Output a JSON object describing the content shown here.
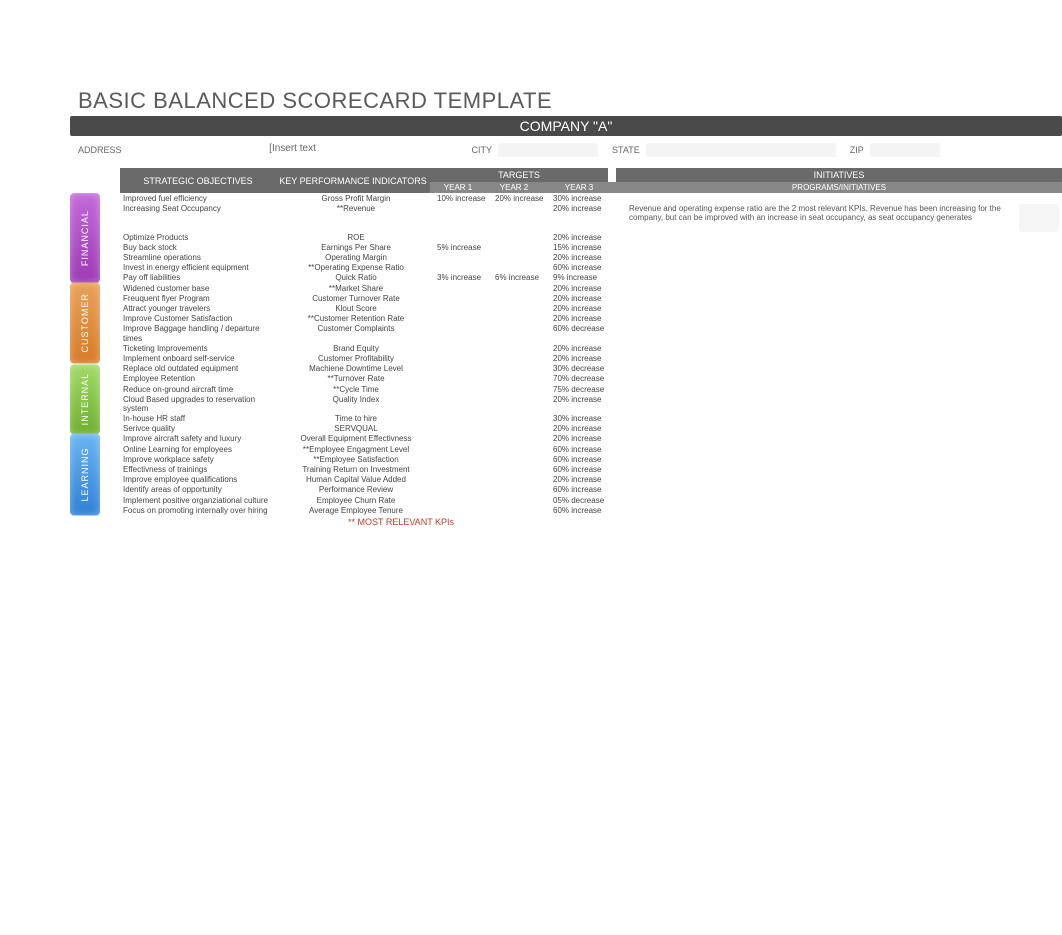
{
  "title": "BASIC BALANCED SCORECARD TEMPLATE",
  "company": "COMPANY \"A\"",
  "address": {
    "label": "ADDRESS",
    "value": "[Insert text",
    "city_label": "CITY",
    "state_label": "STATE",
    "zip_label": "ZIP"
  },
  "headers": {
    "strategic": "STRATEGIC OBJECTIVES",
    "kpi": "KEY PERFORMANCE INDICATORS",
    "targets": "TARGETS",
    "initiatives": "INITIATIVES",
    "year1": "YEAR 1",
    "year2": "YEAR 2",
    "year3": "YEAR 3",
    "programs": "PROGRAMS/INITIATIVES"
  },
  "sections": [
    {
      "name": "FINANCIAL",
      "class": "cat-fin",
      "rows": [
        {
          "obj": "Improved fuel efficiency",
          "kpi": "Gross Profit Margin",
          "y1": "10% increase",
          "y2": "20% increase",
          "y3": "30% increase",
          "init": ""
        },
        {
          "obj": "Increasing Seat Occupancy",
          "kpi": "**Revenue",
          "y1": "",
          "y2": "",
          "y3": "20% increase",
          "init": "Revenue and operating expense ratio are the 2 most relevant KPIs. Revenue has been increasing for the company, but can be improved with an increase in seat occupancy, as seat occupancy generates"
        },
        {
          "obj": "Optimize Products",
          "kpi": "ROE",
          "y1": "",
          "y2": "",
          "y3": "20% increase",
          "init": ""
        },
        {
          "obj": "Buy back stock",
          "kpi": "Earnings Per Share",
          "y1": "5% increase",
          "y2": "",
          "y3": "15% increase",
          "init": ""
        },
        {
          "obj": "Streamline operations",
          "kpi": "Operating Margin",
          "y1": "",
          "y2": "",
          "y3": "20% increase",
          "init": ""
        },
        {
          "obj": "Invest in energy efficient equipment",
          "kpi": "**Operating Expense Ratio",
          "y1": "",
          "y2": "",
          "y3": "60% increase",
          "init": ""
        },
        {
          "obj": "Pay off liabilities",
          "kpi": "Quick Ratio",
          "y1": "3% increase",
          "y2": "6% increase",
          "y3": "9% increase",
          "init": ""
        }
      ]
    },
    {
      "name": "CUSTOMER",
      "class": "cat-cus",
      "rows": [
        {
          "obj": "Widened customer base",
          "kpi": "**Market Share",
          "y1": "",
          "y2": "",
          "y3": "20% increase",
          "init": ""
        },
        {
          "obj": "Freuquent flyer Program",
          "kpi": "Customer Turnover Rate",
          "y1": "",
          "y2": "",
          "y3": "20% increase",
          "init": ""
        },
        {
          "obj": "Attract younger travelers",
          "kpi": "Klout Score",
          "y1": "",
          "y2": "",
          "y3": "20% increase",
          "init": ""
        },
        {
          "obj": "Improve Customer Satisfaction",
          "kpi": "**Customer Retention Rate",
          "y1": "",
          "y2": "",
          "y3": "20% increase",
          "init": ""
        },
        {
          "obj": "  Improve Baggage handling / departure times",
          "kpi": "Customer Complaints",
          "y1": "",
          "y2": "",
          "y3": "60% decrease",
          "init": ""
        },
        {
          "obj": "Ticketing Improvements",
          "kpi": "Brand Equity",
          "y1": "",
          "y2": "",
          "y3": "20% increase",
          "init": ""
        },
        {
          "obj": "Implement onboard self-service",
          "kpi": "Customer Profitability",
          "y1": "",
          "y2": "",
          "y3": "20% increase",
          "init": ""
        }
      ]
    },
    {
      "name": "INTERNAL",
      "class": "cat-int",
      "rows": [
        {
          "obj": "Replace old outdated equipment",
          "kpi": "Machiene Downtime Level",
          "y1": "",
          "y2": "",
          "y3": "30% decrease",
          "init": ""
        },
        {
          "obj": "Employee Retention",
          "kpi": "**Turnover Rate",
          "y1": "",
          "y2": "",
          "y3": "70% decrease",
          "init": ""
        },
        {
          "obj": "Reduce on-ground aircraft time",
          "kpi": "**Cycle Time",
          "y1": "",
          "y2": "",
          "y3": "75% decrease",
          "init": ""
        },
        {
          "obj": "Cloud Based upgrades to reservation system",
          "kpi": "Quality Index",
          "y1": "",
          "y2": "",
          "y3": "20% increase",
          "init": ""
        },
        {
          "obj": "In-house HR staff",
          "kpi": "Time to hire",
          "y1": "",
          "y2": "",
          "y3": "30% increase",
          "init": ""
        },
        {
          "obj": "Serivce quality",
          "kpi": "SERVQUAL",
          "y1": "",
          "y2": "",
          "y3": "20% increase",
          "init": ""
        }
      ]
    },
    {
      "name": "LEARNING",
      "class": "cat-lrn",
      "rows": [
        {
          "obj": "Improve aircraft safety and luxury",
          "kpi": "Overall Equipment Effectivness",
          "y1": "",
          "y2": "",
          "y3": "20% increase",
          "init": ""
        },
        {
          "obj": "Online Learning for employees",
          "kpi": "**Employee Engagment Level",
          "y1": "",
          "y2": "",
          "y3": "60% increase",
          "init": ""
        },
        {
          "obj": "Improve workplace safety",
          "kpi": "**Employee Satisfaction",
          "y1": "",
          "y2": "",
          "y3": "60% increase",
          "init": ""
        },
        {
          "obj": "Effectivness of trainings",
          "kpi": "Training Return on Investment",
          "y1": "",
          "y2": "",
          "y3": "60% increase",
          "init": ""
        },
        {
          "obj": "Improve employee qualifications",
          "kpi": "Human Capital Value Added",
          "y1": "",
          "y2": "",
          "y3": "20% increase",
          "init": ""
        },
        {
          "obj": "Identify areas of opportunity",
          "kpi": "Performance Review",
          "y1": "",
          "y2": "",
          "y3": "60% increase",
          "init": ""
        },
        {
          "obj": "Implement positive organziational culture",
          "kpi": "Employee Churn Rate",
          "y1": "",
          "y2": "",
          "y3": "05% decrease",
          "init": ""
        },
        {
          "obj": "Focus on promoting internally over hiring",
          "kpi": "Average Employee Tenure",
          "y1": "",
          "y2": "",
          "y3": "60% increase",
          "init": ""
        }
      ]
    }
  ],
  "footer": "** MOST RELEVANT KPIs"
}
